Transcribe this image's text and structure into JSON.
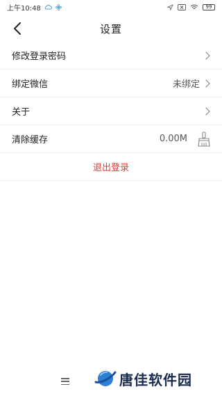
{
  "status_bar": {
    "time": "上午10:48",
    "battery": "99"
  },
  "header": {
    "title": "设置"
  },
  "settings": [
    {
      "label": "修改登录密码",
      "value": "",
      "trailing": "chevron-right-icon"
    },
    {
      "label": "绑定微信",
      "value": "未绑定",
      "trailing": "chevron-right-icon"
    },
    {
      "label": "关于",
      "value": "",
      "trailing": "chevron-right-icon"
    },
    {
      "label": "清除缓存",
      "value": "0.00M",
      "trailing": "broom-icon"
    }
  ],
  "logout": {
    "label": "退出登录",
    "color": "#e53935"
  },
  "watermark": {
    "text": "唐佳软件园"
  }
}
